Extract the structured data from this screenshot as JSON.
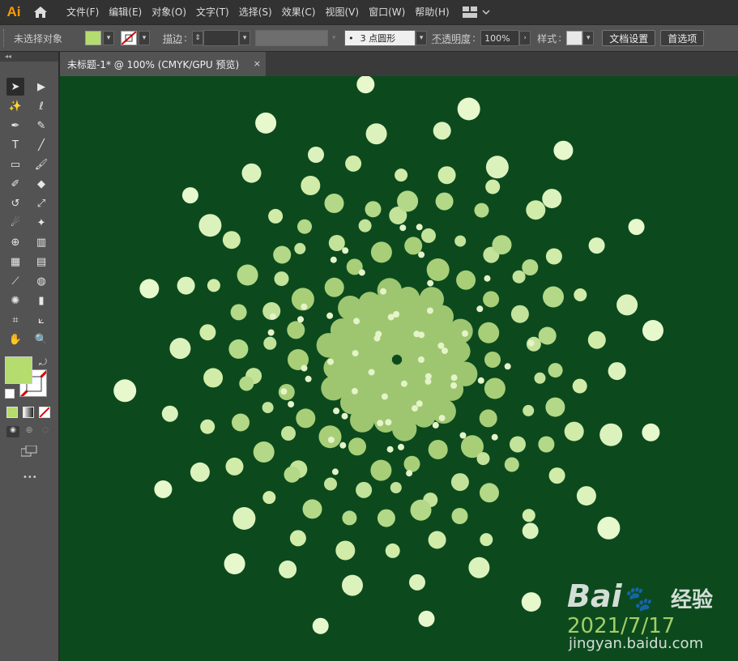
{
  "app": {
    "logo": "Ai"
  },
  "menu": [
    "文件(F)",
    "编辑(E)",
    "对象(O)",
    "文字(T)",
    "选择(S)",
    "效果(C)",
    "视图(V)",
    "窗口(W)",
    "帮助(H)"
  ],
  "control_bar": {
    "selection_label": "未选择对象",
    "fill_color": "#b4dc6e",
    "stroke_label": "描边",
    "brush_value": "3 点圆形",
    "opacity_label": "不透明度",
    "opacity_value": "100%",
    "style_label": "样式",
    "doc_settings_button": "文档设置",
    "prefs_button": "首选项"
  },
  "document_tab": {
    "title": "未标题-1* @ 100% (CMYK/GPU 预览)",
    "close": "×"
  },
  "toolbox": {
    "fill_color": "#b4dc6e",
    "more": "•••"
  },
  "canvas": {
    "background": "#0c4a1e"
  },
  "watermark": {
    "brand": "Bai",
    "brand_suffix": "经验",
    "line1": "2021/7/17",
    "line2": "jingyan.baidu.com"
  },
  "icons": [
    "home-icon",
    "workspace-icon",
    "selection-tool-icon",
    "direct-selection-tool-icon",
    "magic-wand-icon",
    "lasso-icon",
    "pen-tool-icon",
    "curvature-tool-icon",
    "type-tool-icon",
    "line-tool-icon",
    "rectangle-tool-icon",
    "paintbrush-icon",
    "shaper-tool-icon",
    "eraser-icon",
    "rotate-tool-icon",
    "scale-tool-icon",
    "warp-tool-icon",
    "puppet-warp-icon",
    "shape-builder-icon",
    "perspective-grid-icon",
    "mesh-tool-icon",
    "gradient-tool-icon",
    "eyedropper-icon",
    "blend-tool-icon",
    "symbol-sprayer-icon",
    "column-graph-icon",
    "artboard-tool-icon",
    "slice-tool-icon",
    "hand-tool-icon",
    "zoom-tool-icon"
  ]
}
